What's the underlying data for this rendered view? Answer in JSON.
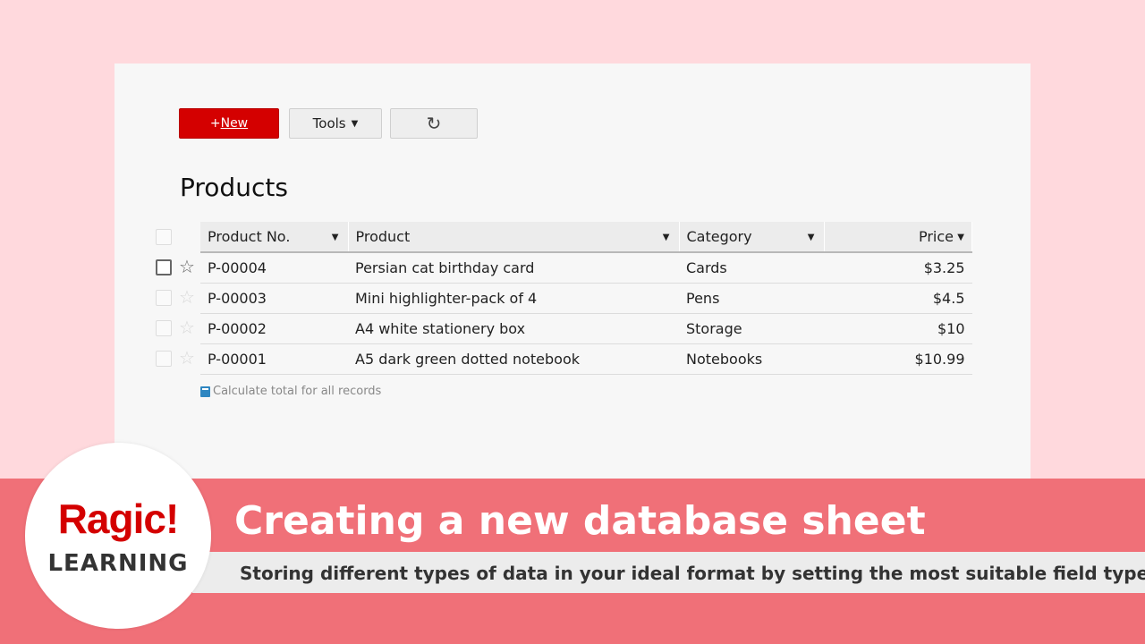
{
  "toolbar": {
    "new_prefix": "+",
    "new_label": "New",
    "tools_label": "Tools",
    "caret": "▼",
    "refresh_glyph": "↻"
  },
  "sheet": {
    "title": "Products",
    "columns": [
      "Product No.",
      "Product",
      "Category",
      "Price"
    ],
    "rows": [
      {
        "no": "P-00004",
        "product": "Persian cat birthday card",
        "category": "Cards",
        "price": "$3.25"
      },
      {
        "no": "P-00003",
        "product": "Mini highlighter-pack of 4",
        "category": "Pens",
        "price": "$4.5"
      },
      {
        "no": "P-00002",
        "product": "A4 white stationery box",
        "category": "Storage",
        "price": "$10"
      },
      {
        "no": "P-00001",
        "product": "A5 dark green dotted notebook",
        "category": "Notebooks",
        "price": "$10.99"
      }
    ],
    "calc_label": "Calculate total for all records"
  },
  "banner": {
    "title": "Creating a new database sheet",
    "subtitle": "Storing different types of data in your ideal format by setting the most suitable field types."
  },
  "logo": {
    "main": "Ragic!",
    "sub": "LEARNING"
  },
  "colors": {
    "brand_red": "#d40000",
    "banner_pink": "#f07078",
    "background_pink": "#ffd9dd"
  }
}
